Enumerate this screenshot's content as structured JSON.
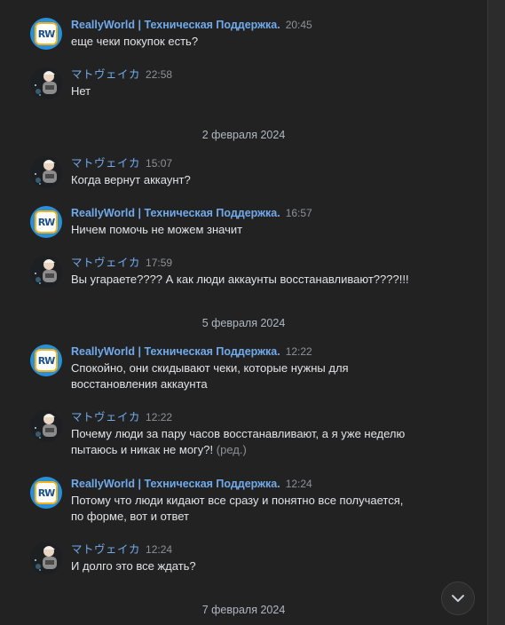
{
  "messages": [
    {
      "author": "ReallyWorld | Техническая Поддержка.",
      "time": "20:45",
      "text": "еще чеки покупок есть?"
    },
    {
      "author": "マトヴェイカ",
      "time": "22:58",
      "text": "Нет"
    },
    {
      "author": "マトヴェイカ",
      "time": "15:07",
      "text": "Когда вернут аккаунт?"
    },
    {
      "author": "ReallyWorld | Техническая Поддержка.",
      "time": "16:57",
      "text": "Ничем помочь не можем значит"
    },
    {
      "author": "マトヴェイカ",
      "time": "17:59",
      "text": "Вы угараете???? А как люди аккаунты восстанавливают????!!!"
    },
    {
      "author": "ReallyWorld | Техническая Поддержка.",
      "time": "12:22",
      "text_line1": "Спокойно, они скидывают чеки, которые нужны для",
      "text_line2": "восстановления аккаунта"
    },
    {
      "author": "マトヴェイカ",
      "time": "12:22",
      "text_line1": "Почему люди за пару часов восстанавливают, а я уже неделю",
      "text_line2": "пытаюсь и никак не могу?!",
      "edited": "(ред.)"
    },
    {
      "author": "ReallyWorld | Техническая Поддержка.",
      "time": "12:24",
      "text_line1": "Потому что люди кидают все сразу и понятно все получается,",
      "text_line2": "по форме, вот и ответ"
    },
    {
      "author": "マトヴェイカ",
      "time": "12:24",
      "text": "И долго это все ждать?"
    }
  ],
  "date_separators": [
    "2 февраля 2024",
    "5 февраля 2024",
    "7 февраля 2024"
  ],
  "support_avatar_logo": "RW",
  "icons": {
    "support_avatar": "reallyworld-logo-icon",
    "user_avatar": "user-avatar-image",
    "scroll_down": "chevron-down-icon"
  },
  "colors": {
    "background": "#222222",
    "author": "#71aaeb",
    "text": "#e1e3e6",
    "time": "#8e9196",
    "date": "#aeb7c2"
  }
}
